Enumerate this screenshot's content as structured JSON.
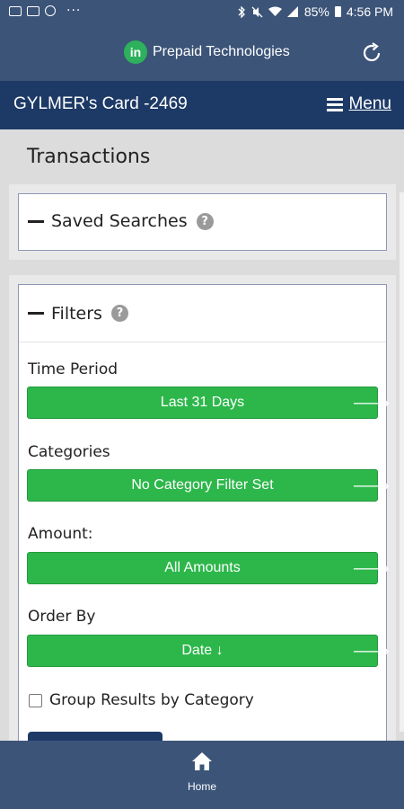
{
  "status_bar": {
    "battery": "85%",
    "time": "4:56 PM",
    "overflow": "···"
  },
  "app_bar": {
    "logo_text": "in",
    "brand_name": "Prepaid Technologies"
  },
  "card_bar": {
    "title": "GYLMER's Card -2469",
    "menu_label": "Menu"
  },
  "page": {
    "title": "Transactions"
  },
  "saved_searches": {
    "heading": "Saved Searches",
    "help": "?"
  },
  "filters": {
    "heading": "Filters",
    "help": "?",
    "time_period_label": "Time Period",
    "time_period_value": "Last 31 Days",
    "categories_label": "Categories",
    "categories_value": "No Category Filter Set",
    "amount_label": "Amount:",
    "amount_value": "All Amounts",
    "order_by_label": "Order By",
    "order_by_value": "Date ↓",
    "group_results_label": "Group Results by Category",
    "group_results_checked": false
  },
  "bottom_nav": {
    "home_label": "Home"
  },
  "colors": {
    "header_bg": "#3c5478",
    "card_bar_bg": "#1d3a66",
    "button_green": "#2db74b",
    "brand_green": "#2db15c"
  },
  "icons": [
    "image-icon",
    "message-icon",
    "chat-icon",
    "bluetooth-icon",
    "mute-icon",
    "wifi-icon",
    "signal-icon",
    "battery-icon",
    "refresh-icon",
    "hamburger-icon",
    "help-icon",
    "arrow-right-icon",
    "home-icon"
  ]
}
